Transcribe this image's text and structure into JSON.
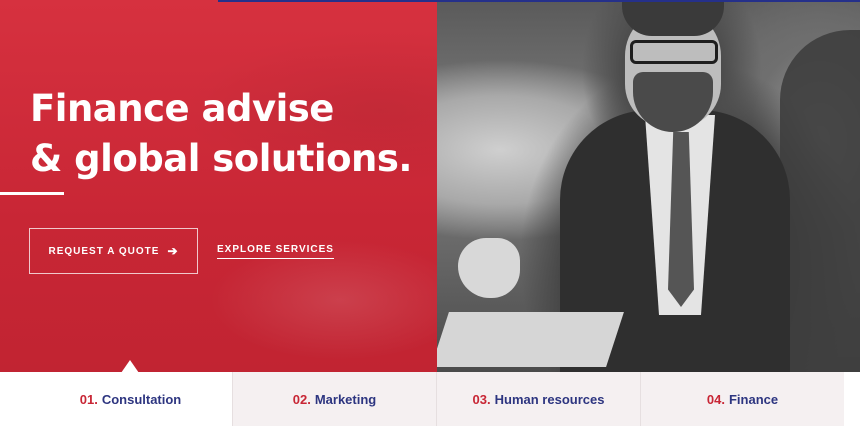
{
  "hero": {
    "headline_line1": "Finance advise",
    "headline_line2": "& global solutions.",
    "quote_button": "REQUEST A QUOTE",
    "quote_button_icon": "arrow-right-icon",
    "explore_link": "EXPLORE SERVICES"
  },
  "colors": {
    "brand_red": "#c82635",
    "brand_navy": "#2d3580",
    "tab_background": "#f5f0f1"
  },
  "tabs": [
    {
      "number": "01.",
      "label": "Consultation",
      "active": true
    },
    {
      "number": "02.",
      "label": "Marketing",
      "active": false
    },
    {
      "number": "03.",
      "label": "Human resources",
      "active": false
    },
    {
      "number": "04.",
      "label": "Finance",
      "active": false
    }
  ]
}
